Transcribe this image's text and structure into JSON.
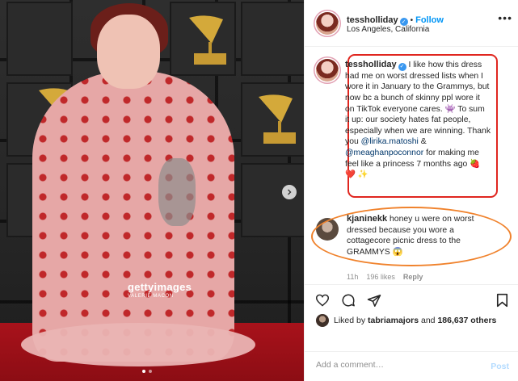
{
  "photo": {
    "watermark_brand": "gettyimages",
    "watermark_credit": "VALERIE MACON",
    "next_icon": "chevron-right-icon",
    "carousel_dots": 2
  },
  "header": {
    "username": "tessholliday",
    "follow_label": "Follow",
    "bullet": "•",
    "location": "Los Angeles, California",
    "more_label": "•••"
  },
  "caption": {
    "username": "tessholliday",
    "text_1": "I like how this dress had me on worst dressed lists when I wore it in January to the Grammys, but now bc a bunch of skinny ppl wore it on TikTok everyone cares. ",
    "emoji_1": "👾",
    "text_2": " To sum it up: our society hates fat people, especially when we are winning. Thank you ",
    "mention_1": "@lirika.matoshi",
    "text_3": " & ",
    "mention_2": "@meaghanpoconnor",
    "text_4": " for making me feel like a princess 7 months ago ",
    "emoji_2": "🍓",
    "emoji_3": "❤️ ✨"
  },
  "comment": {
    "username": "kjaninekk",
    "text": "honey u were on worst dressed because you wore a cottagecore picnic dress to the GRAMMYS ",
    "emoji": "😱",
    "time": "11h",
    "likes": "196 likes",
    "reply_label": "Reply"
  },
  "actions": {
    "likes_prefix": "Liked by ",
    "liked_by_user": "tabriamajors",
    "likes_suffix": " and ",
    "likes_count": "186,637 others"
  },
  "add_comment": {
    "placeholder": "Add a comment…",
    "post_label": "Post"
  },
  "colors": {
    "accent_blue": "#0095f6",
    "caption_highlight": "#e0261f",
    "comment_highlight": "#f0822c"
  }
}
